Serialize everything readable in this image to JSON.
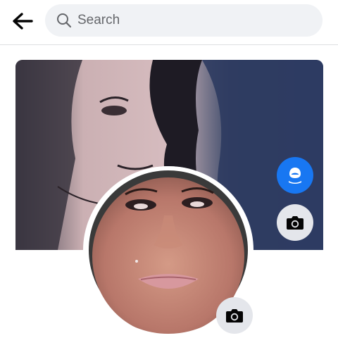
{
  "header": {
    "back_icon": "arrow-left-icon",
    "search": {
      "placeholder": "Search",
      "value": "",
      "icon": "search-icon"
    }
  },
  "cover": {
    "image": "cover-photo",
    "buttons": [
      {
        "icon": "avatar-icon",
        "color": "#1877f2"
      },
      {
        "icon": "camera-icon",
        "color": "#e4e6eb"
      }
    ]
  },
  "profile": {
    "image": "profile-photo",
    "camera_icon": "camera-icon"
  },
  "colors": {
    "accent": "#1877f2",
    "search_bg": "#f0f2f5",
    "button_bg": "#e4e6eb"
  }
}
